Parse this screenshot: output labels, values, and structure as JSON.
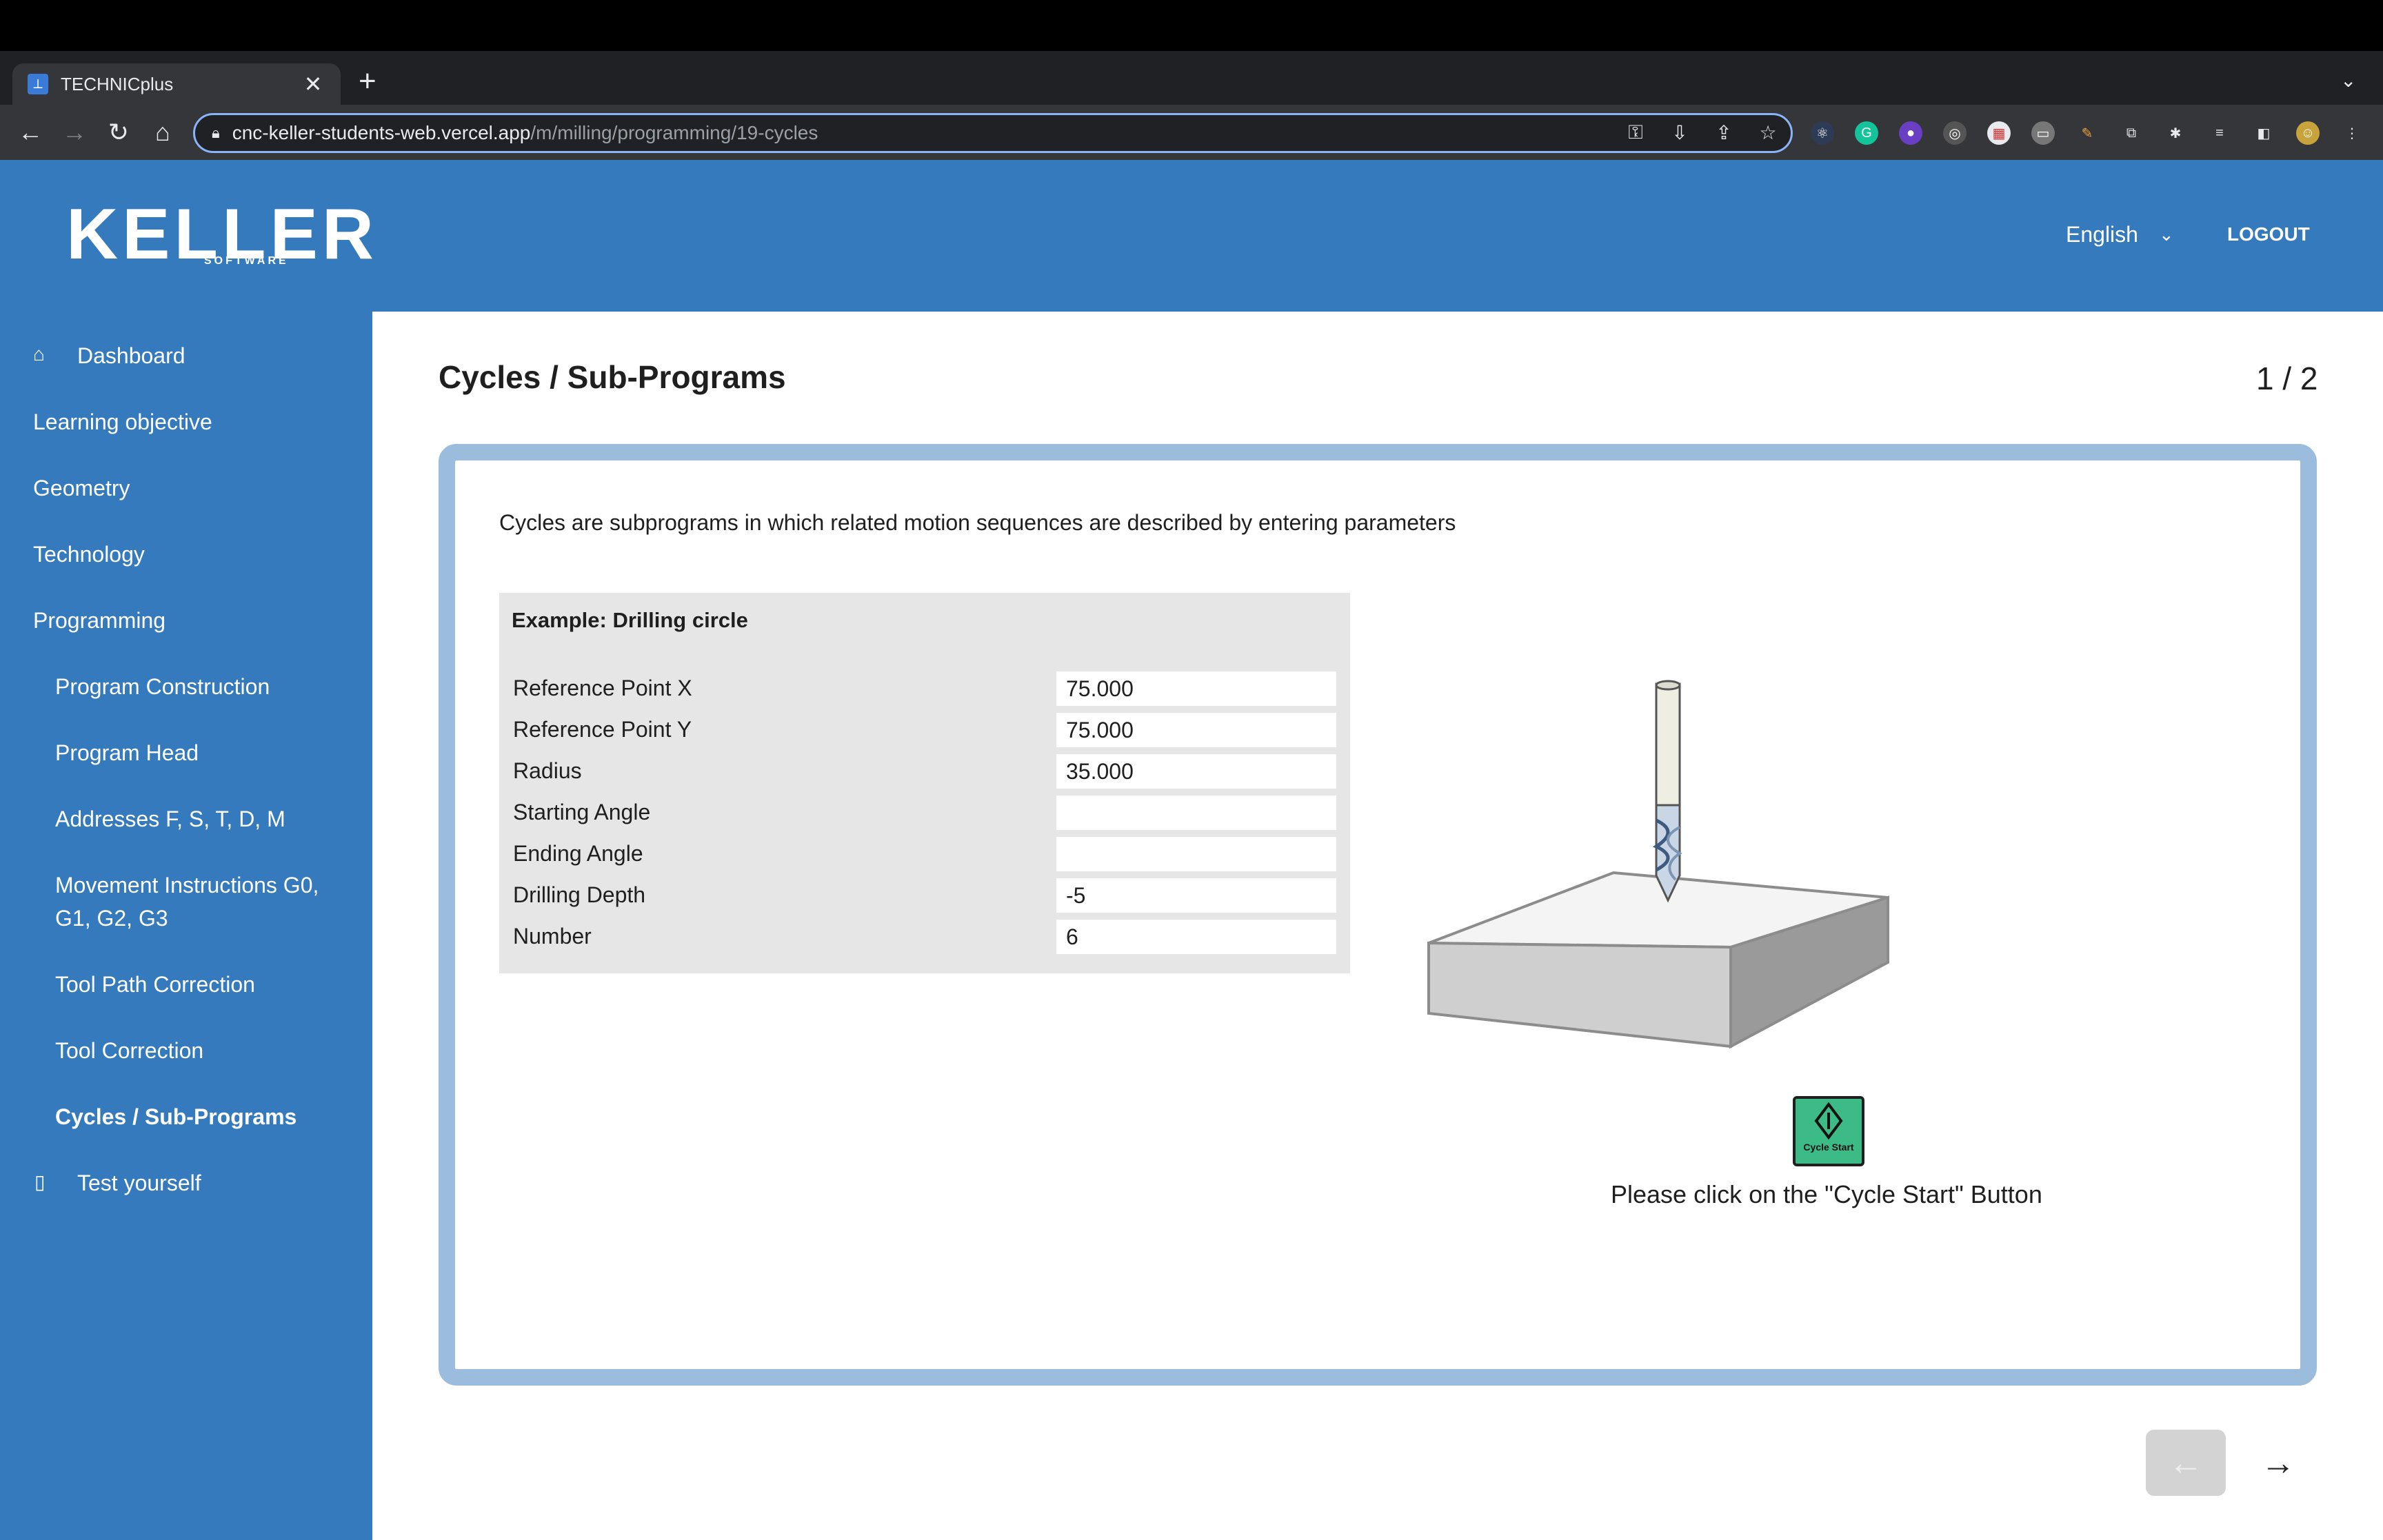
{
  "browser": {
    "tab_title": "TECHNICplus",
    "tab_close": "✕",
    "new_tab": "+",
    "url_host": "cnc-keller-students-web.vercel.app",
    "url_path": "/m/milling/programming/19-cycles"
  },
  "header": {
    "logo": "KELLER",
    "logo_sub": "SOFTWARE",
    "language": "English",
    "logout": "LOGOUT"
  },
  "sidebar": {
    "items": [
      {
        "label": "Dashboard"
      },
      {
        "label": "Learning objective"
      },
      {
        "label": "Geometry"
      },
      {
        "label": "Technology"
      },
      {
        "label": "Programming"
      },
      {
        "label": "Program Construction"
      },
      {
        "label": "Program Head"
      },
      {
        "label": "Addresses F, S, T, D, M"
      },
      {
        "label": "Movement Instructions G0,"
      },
      {
        "label": "G1, G2, G3"
      },
      {
        "label": "Tool Path Correction"
      },
      {
        "label": "Tool Correction"
      },
      {
        "label": "Cycles / Sub-Programs"
      },
      {
        "label": "Test yourself"
      }
    ]
  },
  "main": {
    "title": "Cycles / Sub-Programs",
    "page_counter": "1 / 2",
    "intro": "Cycles are subprograms in which related motion sequences are described by entering parameters",
    "example": {
      "heading": "Example: Drilling circle",
      "rows": [
        {
          "label": "Reference Point X",
          "value": "75.000"
        },
        {
          "label": "Reference Point Y",
          "value": "75.000"
        },
        {
          "label": "Radius",
          "value": "35.000"
        },
        {
          "label": "Starting Angle",
          "value": ""
        },
        {
          "label": "Ending Angle",
          "value": ""
        },
        {
          "label": "Drilling Depth",
          "value": "-5"
        },
        {
          "label": "Number",
          "value": "6"
        }
      ]
    },
    "cycle_button_label": "Cycle Start",
    "cycle_hint": "Please click on the \"Cycle Start\" Button"
  },
  "colors": {
    "brand_blue": "#357abd",
    "frame_blue": "#9bbcdc",
    "cycle_green": "#3dbb86"
  }
}
